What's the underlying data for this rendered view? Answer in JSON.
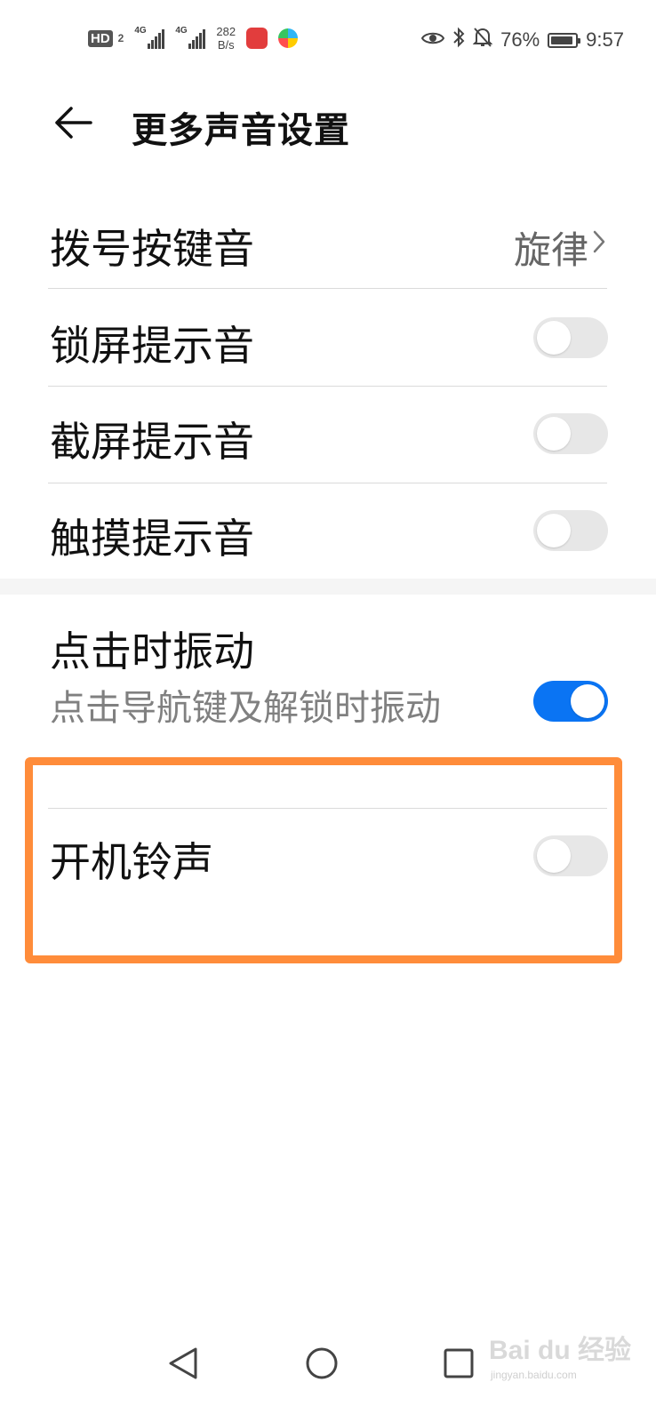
{
  "status_bar": {
    "hd_label": "HD",
    "hd_sub": "2",
    "network1": "4G",
    "network2": "4G",
    "speed_value": "282",
    "speed_unit": "B/s",
    "battery_percent": "76%",
    "time": "9:57",
    "battery_level": 0.76,
    "icons": [
      "eye-icon",
      "bluetooth-icon",
      "silent-bell-icon",
      "battery-icon"
    ]
  },
  "header": {
    "title": "更多声音设置"
  },
  "settings": {
    "dialpad": {
      "label": "拨号按键音",
      "value": "旋律"
    },
    "lock_screen": {
      "label": "锁屏提示音",
      "enabled": false
    },
    "screenshot": {
      "label": "截屏提示音",
      "enabled": false
    },
    "touch": {
      "label": "触摸提示音",
      "enabled": false
    },
    "tap_vibration": {
      "label": "点击时振动",
      "subtitle": "点击导航键及解锁时振动",
      "enabled": true
    },
    "boot_ringtone": {
      "label": "开机铃声",
      "enabled": false
    }
  },
  "colors": {
    "accent": "#0a74f3",
    "highlight": "#ff8c3a",
    "toggle_off": "#e7e7e7"
  },
  "nav": {
    "buttons": [
      "back-triangle-icon",
      "home-circle-icon",
      "recents-square-icon"
    ]
  },
  "watermark": {
    "text": "Bai du 经验",
    "url": "jingyan.baidu.com"
  }
}
